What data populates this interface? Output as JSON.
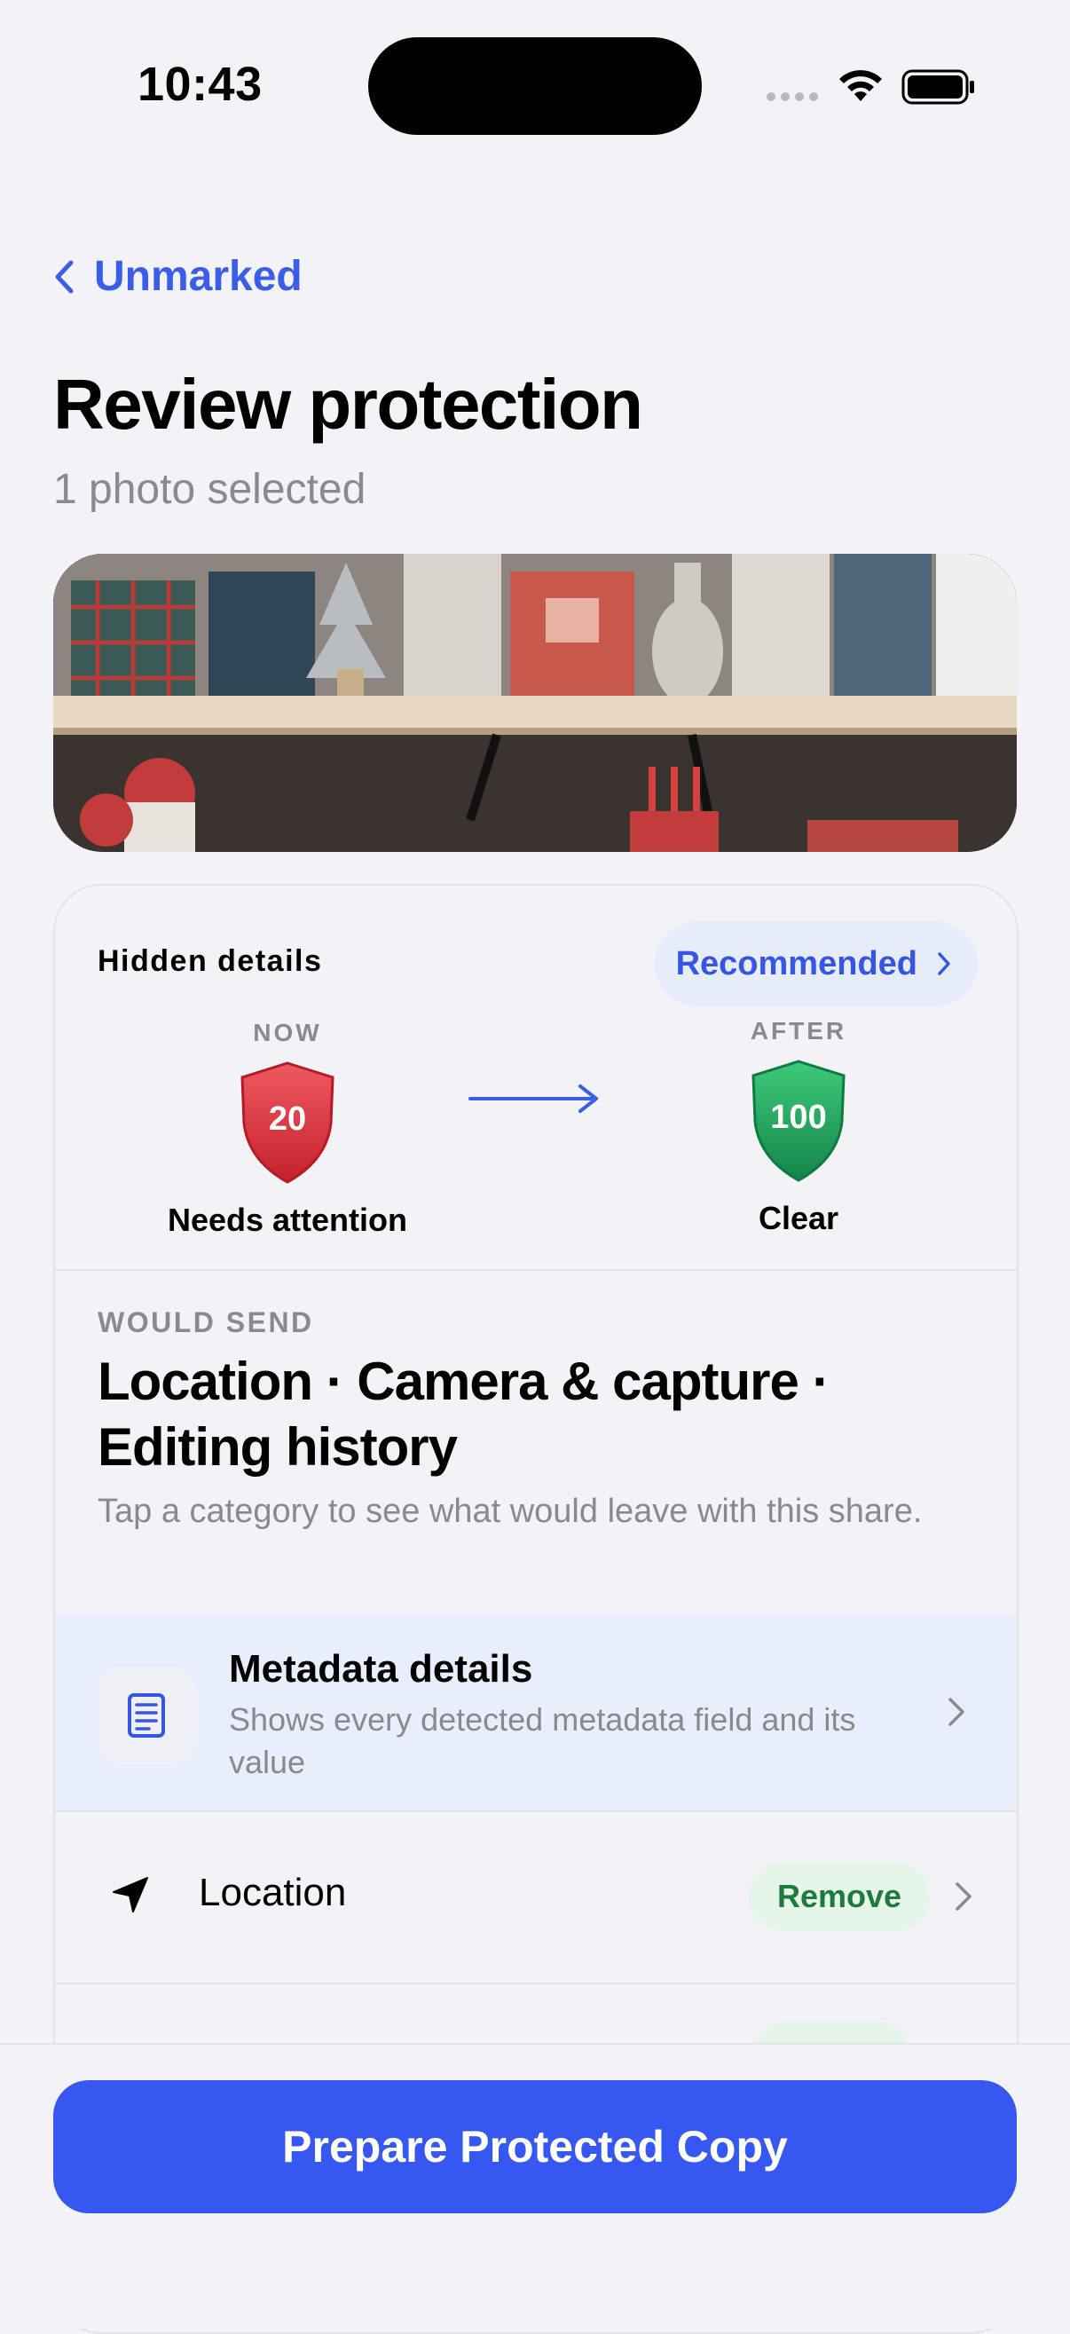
{
  "status_bar": {
    "time": "10:43"
  },
  "nav": {
    "back_label": "Unmarked"
  },
  "header": {
    "title": "Review protection",
    "subtitle": "1 photo selected"
  },
  "hidden_details": {
    "header": "Hidden details",
    "recommended_label": "Recommended",
    "now": {
      "label": "NOW",
      "score": "20",
      "status": "Needs attention",
      "color": "#d8323c"
    },
    "after": {
      "label": "AFTER",
      "score": "100",
      "status": "Clear",
      "color": "#1f9d55"
    }
  },
  "would_send": {
    "label": "WOULD SEND",
    "title": "Location · Camera & capture · Editing history",
    "description": "Tap a category to see what would leave with this share."
  },
  "metadata_row": {
    "title": "Metadata details",
    "description": "Shows every detected metadata field and its value",
    "icon": "document-list-icon"
  },
  "location_row": {
    "label": "Location",
    "action": "Remove",
    "icon": "location-arrow-icon"
  },
  "primary_action": {
    "label": "Prepare Protected Copy",
    "color": "#3658f0"
  },
  "colors": {
    "accent": "#3b5ee8",
    "background": "#f2f2f7",
    "remove_text": "#1f7a3d",
    "remove_bg": "#e6f5ea"
  }
}
